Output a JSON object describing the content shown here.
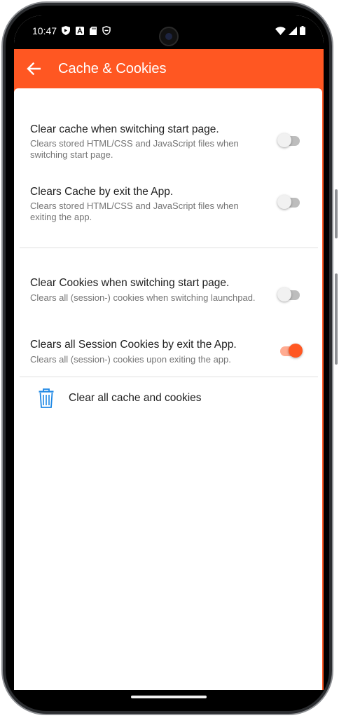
{
  "status_bar": {
    "time": "10:47",
    "left_icons": [
      "shield-icon",
      "a-box-icon",
      "sd-card-icon",
      "vpn-shield-icon"
    ],
    "right_icons": [
      "wifi-icon",
      "signal-icon",
      "battery-icon"
    ]
  },
  "app_bar": {
    "title": "Cache & Cookies",
    "back_icon": "arrow-left-icon",
    "color": "#ff5722"
  },
  "preferences": [
    {
      "title": "Clear cache when switching start page.",
      "summary": "Clears stored HTML/CSS and JavaScript files when switching start page.",
      "enabled": false
    },
    {
      "title": "Clears Cache by exit the App.",
      "summary": "Clears stored HTML/CSS and JavaScript files when exiting the app.",
      "enabled": false
    },
    {
      "title": "Clear Cookies when switching start page.",
      "summary": "Clears all (session-) cookies when switching launchpad.",
      "enabled": false
    },
    {
      "title": "Clears all Session Cookies by exit the App.",
      "summary": "Clears all (session-) cookies upon exiting the app.",
      "enabled": true
    }
  ],
  "clear_action": {
    "label": "Clear all cache and cookies",
    "icon": "trash-icon",
    "icon_color": "#1e88e5"
  },
  "colors": {
    "accent": "#ff5722",
    "switch_on_track": "#ffab91",
    "switch_off_track": "#bdbdbd"
  }
}
